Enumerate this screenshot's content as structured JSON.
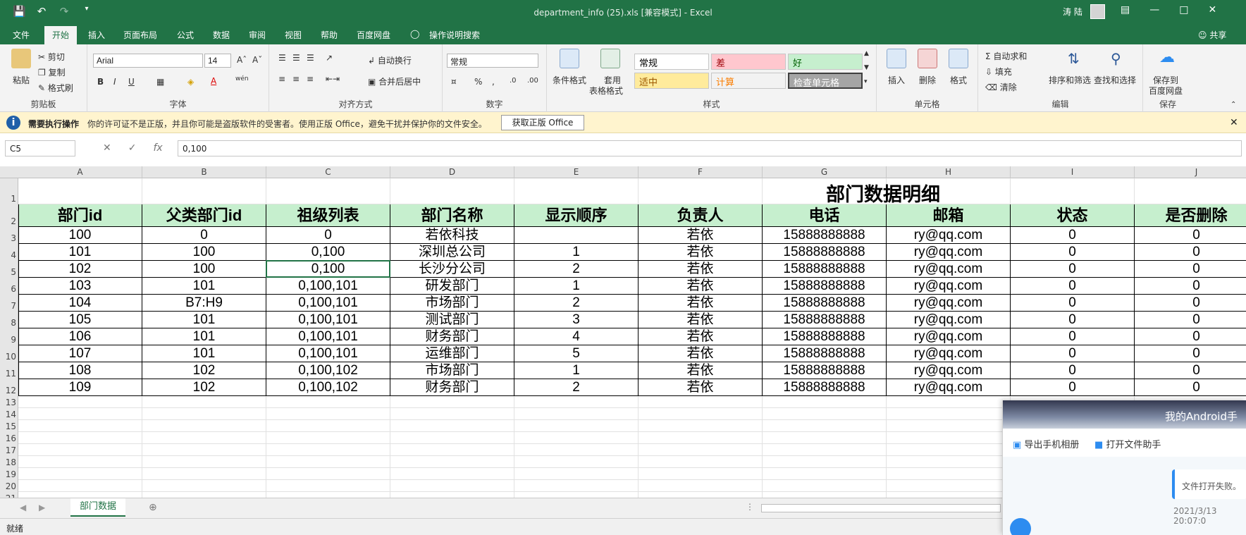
{
  "window": {
    "title": "department_info (25).xls  [兼容模式]  -  Excel",
    "user": "涛 陆"
  },
  "menu": {
    "items": [
      "文件",
      "开始",
      "插入",
      "页面布局",
      "公式",
      "数据",
      "审阅",
      "视图",
      "帮助",
      "百度网盘"
    ],
    "search": "操作说明搜索",
    "share": "共享"
  },
  "ribbon": {
    "clipboard": {
      "label": "剪贴板",
      "paste": "粘贴",
      "cut": "剪切",
      "copy": "复制",
      "format_painter": "格式刷"
    },
    "font": {
      "label": "字体",
      "name": "Arial",
      "size": "14",
      "bold": "B",
      "italic": "I",
      "underline": "U"
    },
    "alignment": {
      "label": "对齐方式",
      "wrap": "自动换行",
      "merge": "合并后居中"
    },
    "number": {
      "label": "数字",
      "format": "常规"
    },
    "styles": {
      "label": "样式",
      "cond_format": "条件格式",
      "table_format_1": "套用",
      "table_format_2": "表格格式",
      "cells": [
        {
          "text": "常规",
          "bg": "#ffffff",
          "fg": "#000000"
        },
        {
          "text": "差",
          "bg": "#ffc7ce",
          "fg": "#9c0006"
        },
        {
          "text": "好",
          "bg": "#c6efce",
          "fg": "#006100"
        },
        {
          "text": "适中",
          "bg": "#ffeb9c",
          "fg": "#9c5700"
        },
        {
          "text": "计算",
          "bg": "#f2f2f2",
          "fg": "#fa7d00"
        },
        {
          "text": "检查单元格",
          "bg": "#a5a5a5",
          "fg": "#ffffff"
        }
      ]
    },
    "cells": {
      "label": "单元格",
      "insert": "插入",
      "delete": "删除",
      "format": "格式"
    },
    "editing": {
      "label": "编辑",
      "autosum": "自动求和",
      "fill": "填充",
      "clear": "清除",
      "sort": "排序和筛选",
      "find": "查找和选择"
    },
    "save": {
      "label": "保存",
      "save_to": "保存到",
      "baidu": "百度网盘"
    }
  },
  "message": {
    "title": "需要执行操作",
    "text": "你的许可证不是正版，并且你可能是盗版软件的受害者。使用正版 Office，避免干扰并保护你的文件安全。",
    "button": "获取正版 Office"
  },
  "formula_bar": {
    "name_box": "C5",
    "formula": "0,100",
    "fx": "fx"
  },
  "sheet": {
    "columns": [
      "A",
      "B",
      "C",
      "D",
      "E",
      "F",
      "G",
      "H",
      "I",
      "J"
    ],
    "rows": [
      "1",
      "2",
      "3",
      "4",
      "5",
      "6",
      "7",
      "8",
      "9",
      "10",
      "11",
      "12",
      "13",
      "14",
      "15",
      "16",
      "17",
      "18",
      "19",
      "20",
      "21"
    ],
    "title": "部门数据明细",
    "headers": [
      "部门id",
      "父类部门id",
      "祖级列表",
      "部门名称",
      "显示顺序",
      "负责人",
      "电话",
      "邮箱",
      "状态",
      "是否删除"
    ],
    "data": [
      [
        "100",
        "0",
        "0",
        "若依科技",
        "",
        "若依",
        "15888888888",
        "ry@qq.com",
        "0",
        "0"
      ],
      [
        "101",
        "100",
        "0,100",
        "深圳总公司",
        "1",
        "若依",
        "15888888888",
        "ry@qq.com",
        "0",
        "0"
      ],
      [
        "102",
        "100",
        "0,100",
        "长沙分公司",
        "2",
        "若依",
        "15888888888",
        "ry@qq.com",
        "0",
        "0"
      ],
      [
        "103",
        "101",
        "0,100,101",
        "研发部门",
        "1",
        "若依",
        "15888888888",
        "ry@qq.com",
        "0",
        "0"
      ],
      [
        "104",
        "B7:H9",
        "0,100,101",
        "市场部门",
        "2",
        "若依",
        "15888888888",
        "ry@qq.com",
        "0",
        "0"
      ],
      [
        "105",
        "101",
        "0,100,101",
        "测试部门",
        "3",
        "若依",
        "15888888888",
        "ry@qq.com",
        "0",
        "0"
      ],
      [
        "106",
        "101",
        "0,100,101",
        "财务部门",
        "4",
        "若依",
        "15888888888",
        "ry@qq.com",
        "0",
        "0"
      ],
      [
        "107",
        "101",
        "0,100,101",
        "运维部门",
        "5",
        "若依",
        "15888888888",
        "ry@qq.com",
        "0",
        "0"
      ],
      [
        "108",
        "102",
        "0,100,102",
        "市场部门",
        "1",
        "若依",
        "15888888888",
        "ry@qq.com",
        "0",
        "0"
      ],
      [
        "109",
        "102",
        "0,100,102",
        "财务部门",
        "2",
        "若依",
        "15888888888",
        "ry@qq.com",
        "0",
        "0"
      ]
    ],
    "tab": "部门数据"
  },
  "status": {
    "text": "就绪"
  },
  "popup": {
    "title": "我的Android手",
    "export": "导出手机相册",
    "open": "打开文件助手",
    "fail": "文件打开失败。",
    "time": "2021/3/13 20:07:0"
  },
  "colors": {
    "excel_green": "#217346",
    "header_green": "#c6efce"
  }
}
